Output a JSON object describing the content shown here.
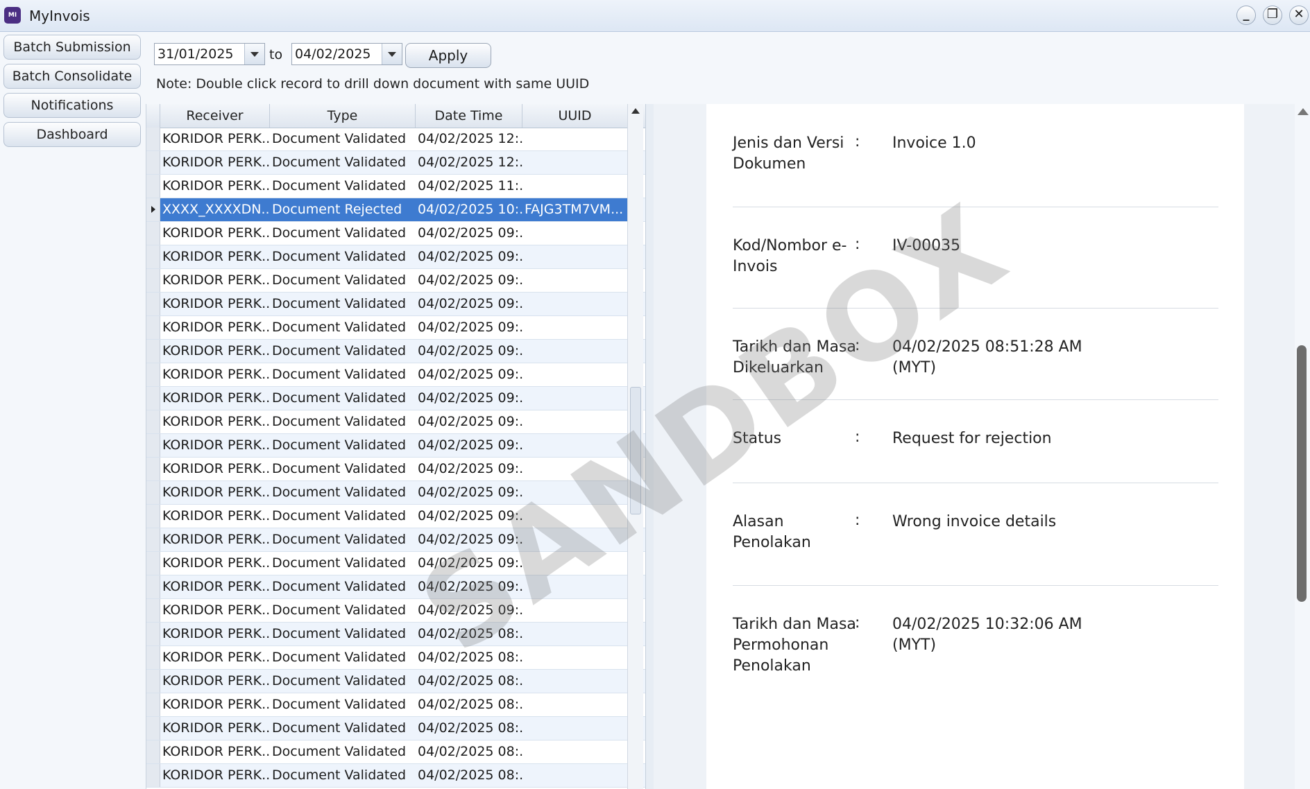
{
  "window": {
    "title": "MyInvois",
    "icon": "myinvois-app-icon",
    "controls": [
      "_",
      "❐",
      "✕"
    ]
  },
  "nav": {
    "items": [
      "Batch Submission",
      "Batch Consolidate",
      "Notifications",
      "Dashboard"
    ]
  },
  "filter": {
    "date_from": "31/01/2025",
    "to_label": "to",
    "date_to": "04/02/2025",
    "apply_label": "Apply",
    "note": "Note: Double click record to drill down document with same UUID"
  },
  "table": {
    "headers": [
      "Receiver",
      "Type",
      "Date Time",
      "UUID"
    ],
    "rows": [
      {
        "receiver": "KORIDOR PERK...",
        "type": "Document Validated",
        "datetime": "04/02/2025 12:...",
        "uuid": ""
      },
      {
        "receiver": "KORIDOR PERK...",
        "type": "Document Validated",
        "datetime": "04/02/2025 12:...",
        "uuid": ""
      },
      {
        "receiver": "KORIDOR PERK...",
        "type": "Document Validated",
        "datetime": "04/02/2025 11:...",
        "uuid": ""
      },
      {
        "receiver": "XXXX_XXXXDN...",
        "type": "Document Rejected",
        "datetime": "04/02/2025 10:...",
        "uuid": "FAJG3TM7VM..."
      },
      {
        "receiver": "KORIDOR PERK...",
        "type": "Document Validated",
        "datetime": "04/02/2025 09:...",
        "uuid": ""
      },
      {
        "receiver": "KORIDOR PERK...",
        "type": "Document Validated",
        "datetime": "04/02/2025 09:...",
        "uuid": ""
      },
      {
        "receiver": "KORIDOR PERK...",
        "type": "Document Validated",
        "datetime": "04/02/2025 09:...",
        "uuid": ""
      },
      {
        "receiver": "KORIDOR PERK...",
        "type": "Document Validated",
        "datetime": "04/02/2025 09:...",
        "uuid": ""
      },
      {
        "receiver": "KORIDOR PERK...",
        "type": "Document Validated",
        "datetime": "04/02/2025 09:...",
        "uuid": ""
      },
      {
        "receiver": "KORIDOR PERK...",
        "type": "Document Validated",
        "datetime": "04/02/2025 09:...",
        "uuid": ""
      },
      {
        "receiver": "KORIDOR PERK...",
        "type": "Document Validated",
        "datetime": "04/02/2025 09:...",
        "uuid": ""
      },
      {
        "receiver": "KORIDOR PERK...",
        "type": "Document Validated",
        "datetime": "04/02/2025 09:...",
        "uuid": ""
      },
      {
        "receiver": "KORIDOR PERK...",
        "type": "Document Validated",
        "datetime": "04/02/2025 09:...",
        "uuid": ""
      },
      {
        "receiver": "KORIDOR PERK...",
        "type": "Document Validated",
        "datetime": "04/02/2025 09:...",
        "uuid": ""
      },
      {
        "receiver": "KORIDOR PERK...",
        "type": "Document Validated",
        "datetime": "04/02/2025 09:...",
        "uuid": ""
      },
      {
        "receiver": "KORIDOR PERK...",
        "type": "Document Validated",
        "datetime": "04/02/2025 09:...",
        "uuid": ""
      },
      {
        "receiver": "KORIDOR PERK...",
        "type": "Document Validated",
        "datetime": "04/02/2025 09:...",
        "uuid": ""
      },
      {
        "receiver": "KORIDOR PERK...",
        "type": "Document Validated",
        "datetime": "04/02/2025 09:...",
        "uuid": ""
      },
      {
        "receiver": "KORIDOR PERK...",
        "type": "Document Validated",
        "datetime": "04/02/2025 09:...",
        "uuid": ""
      },
      {
        "receiver": "KORIDOR PERK...",
        "type": "Document Validated",
        "datetime": "04/02/2025 09:...",
        "uuid": ""
      },
      {
        "receiver": "KORIDOR PERK...",
        "type": "Document Validated",
        "datetime": "04/02/2025 09:...",
        "uuid": ""
      },
      {
        "receiver": "KORIDOR PERK...",
        "type": "Document Validated",
        "datetime": "04/02/2025 08:...",
        "uuid": ""
      },
      {
        "receiver": "KORIDOR PERK...",
        "type": "Document Validated",
        "datetime": "04/02/2025 08:...",
        "uuid": ""
      },
      {
        "receiver": "KORIDOR PERK...",
        "type": "Document Validated",
        "datetime": "04/02/2025 08:...",
        "uuid": ""
      },
      {
        "receiver": "KORIDOR PERK...",
        "type": "Document Validated",
        "datetime": "04/02/2025 08:...",
        "uuid": ""
      },
      {
        "receiver": "KORIDOR PERK...",
        "type": "Document Validated",
        "datetime": "04/02/2025 08:...",
        "uuid": ""
      },
      {
        "receiver": "KORIDOR PERK...",
        "type": "Document Validated",
        "datetime": "04/02/2025 08:...",
        "uuid": ""
      },
      {
        "receiver": "KORIDOR PERK...",
        "type": "Document Validated",
        "datetime": "04/02/2025 08:...",
        "uuid": ""
      }
    ],
    "selected_row": 3
  },
  "details": {
    "fields": [
      {
        "label_lines": [
          "Jenis dan Versi",
          "Dokumen"
        ],
        "value_lines": [
          "Invoice 1.0"
        ]
      },
      {
        "label_lines": [
          "Kod/Nombor e-",
          "Invois"
        ],
        "value_lines": [
          "IV-00035"
        ]
      },
      {
        "label_lines": [
          "Tarikh dan Masa",
          "Dikeluarkan"
        ],
        "value_lines": [
          "04/02/2025 08:51:28 AM",
          "(MYT)"
        ]
      },
      {
        "label_lines": [
          "Status"
        ],
        "value_lines": [
          "Request for rejection"
        ]
      },
      {
        "label_lines": [
          "Alasan",
          "Penolakan"
        ],
        "value_lines": [
          "Wrong invoice details"
        ]
      },
      {
        "label_lines": [
          "Tarikh dan Masa",
          "Permohonan",
          "Penolakan"
        ],
        "value_lines": [
          "04/02/2025 10:32:06 AM",
          "(MYT)"
        ]
      }
    ],
    "colon": ":"
  },
  "watermark": "SANDBOX",
  "colors": {
    "selection": "#3e7bd0",
    "alt_row": "#eef4fc"
  }
}
